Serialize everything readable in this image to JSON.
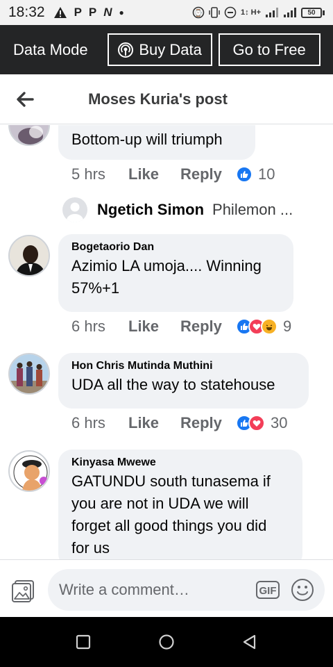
{
  "status_bar": {
    "time": "18:32",
    "left_icons": [
      "warning-icon",
      "p-icon",
      "p-icon",
      "n-icon",
      "dot-icon"
    ],
    "right_icons": [
      "dnd-icon",
      "vibrate-icon",
      "minus-circle-icon",
      "data-icon",
      "signal-icon",
      "signal-icon"
    ],
    "network_label": "1↕ H+",
    "battery": "50"
  },
  "data_bar": {
    "mode_label": "Data Mode",
    "buy_data_label": "Buy Data",
    "go_free_label": "Go to Free"
  },
  "header": {
    "title": "Moses Kuria's post"
  },
  "comments": [
    {
      "text": "Bottom-up will triumph",
      "time": "5 hrs",
      "like_label": "Like",
      "reply_label": "Reply",
      "reactions": [
        "like"
      ],
      "reaction_count": "10",
      "reply_preview": {
        "name": "Ngetich Simon",
        "text": "Philemon ..."
      }
    },
    {
      "author": "Bogetaorio Dan",
      "text_lines": [
        "Azimio LA umoja.... Winning",
        "57%+1"
      ],
      "time": "6 hrs",
      "like_label": "Like",
      "reply_label": "Reply",
      "reactions": [
        "like",
        "love",
        "haha"
      ],
      "reaction_count": "9"
    },
    {
      "author": "Hon Chris Mutinda Muthini",
      "text": "UDA all the way to statehouse",
      "time": "6 hrs",
      "like_label": "Like",
      "reply_label": "Reply",
      "reactions": [
        "like",
        "love"
      ],
      "reaction_count": "30"
    },
    {
      "author": "Kinyasa Mwewe",
      "text_lines": [
        "GATUNDU south tunasema if",
        "you are not in UDA we will",
        "forget all good things you did",
        "for us"
      ]
    }
  ],
  "composer": {
    "placeholder": "Write a comment…",
    "gif_label": "GIF"
  },
  "colors": {
    "data_bar_bg": "#242526",
    "bubble_bg": "#f0f2f5",
    "like_blue": "#1877f2",
    "love_red": "#f33e58",
    "haha_yellow": "#f7b125"
  }
}
